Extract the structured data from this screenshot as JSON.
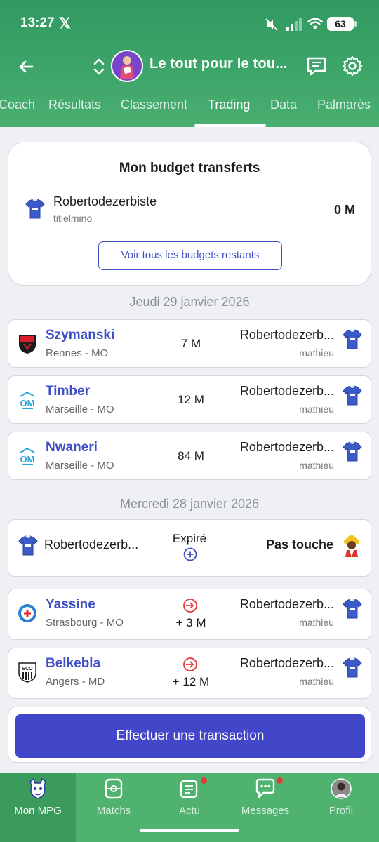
{
  "status_bar": {
    "time": "13:27",
    "x_label": "𝕏",
    "battery": "63"
  },
  "header": {
    "league_title": "Le tout pour le tou...",
    "tabs": [
      "Coach",
      "Résultats",
      "Classement",
      "Trading",
      "Data",
      "Palmarès"
    ],
    "active_tab": "Trading",
    "accent": "#3ea567"
  },
  "budget": {
    "title": "Mon budget transferts",
    "team": "Robertodezerbiste",
    "user": "titielmino",
    "amount": "0 M",
    "button_label": "Voir tous les budgets restants"
  },
  "sections": [
    {
      "date": "Jeudi 29 janvier 2026",
      "transfers": [
        {
          "player": "Szymanski",
          "info": "Rennes - MO",
          "amount": "7 M",
          "to_team": "Robertodezerb...",
          "to_user": "mathieu",
          "club_icon": "rennes-logo"
        },
        {
          "player": "Timber",
          "info": "Marseille - MO",
          "amount": "12 M",
          "to_team": "Robertodezerb...",
          "to_user": "mathieu",
          "club_icon": "marseille-logo"
        },
        {
          "player": "Nwaneri",
          "info": "Marseille - MO",
          "amount": "84 M",
          "to_team": "Robertodezerb...",
          "to_user": "mathieu",
          "club_icon": "marseille-logo"
        }
      ]
    },
    {
      "date": "Mercredi 28 janvier 2026",
      "expired": {
        "left_team": "Robertodezerb...",
        "status": "Expiré",
        "right_team": "Pas touche"
      },
      "transfers": [
        {
          "player": "Yassine",
          "info": "Strasbourg - MO",
          "amount": "+ 3 M",
          "to_team": "Robertodezerb...",
          "to_user": "mathieu",
          "club_icon": "strasbourg-logo"
        },
        {
          "player": "Belkebla",
          "info": "Angers - MD",
          "amount": "+ 12 M",
          "to_team": "Robertodezerb...",
          "to_user": "mathieu",
          "club_icon": "angers-logo"
        }
      ]
    }
  ],
  "action_button": "Effectuer une transaction",
  "bottom_nav": [
    {
      "label": "Mon MPG",
      "icon": "mpg-logo-icon",
      "active": true
    },
    {
      "label": "Matchs",
      "icon": "match-icon"
    },
    {
      "label": "Actu",
      "icon": "news-icon",
      "badge": true
    },
    {
      "label": "Messages",
      "icon": "chat-icon",
      "badge": true
    },
    {
      "label": "Profil",
      "icon": "profile-avatar"
    }
  ],
  "colors": {
    "brand_green": "#3ea567",
    "link_blue": "#3f4fc5",
    "button_blue": "#4147c8",
    "badge_red": "#e23a3a"
  }
}
